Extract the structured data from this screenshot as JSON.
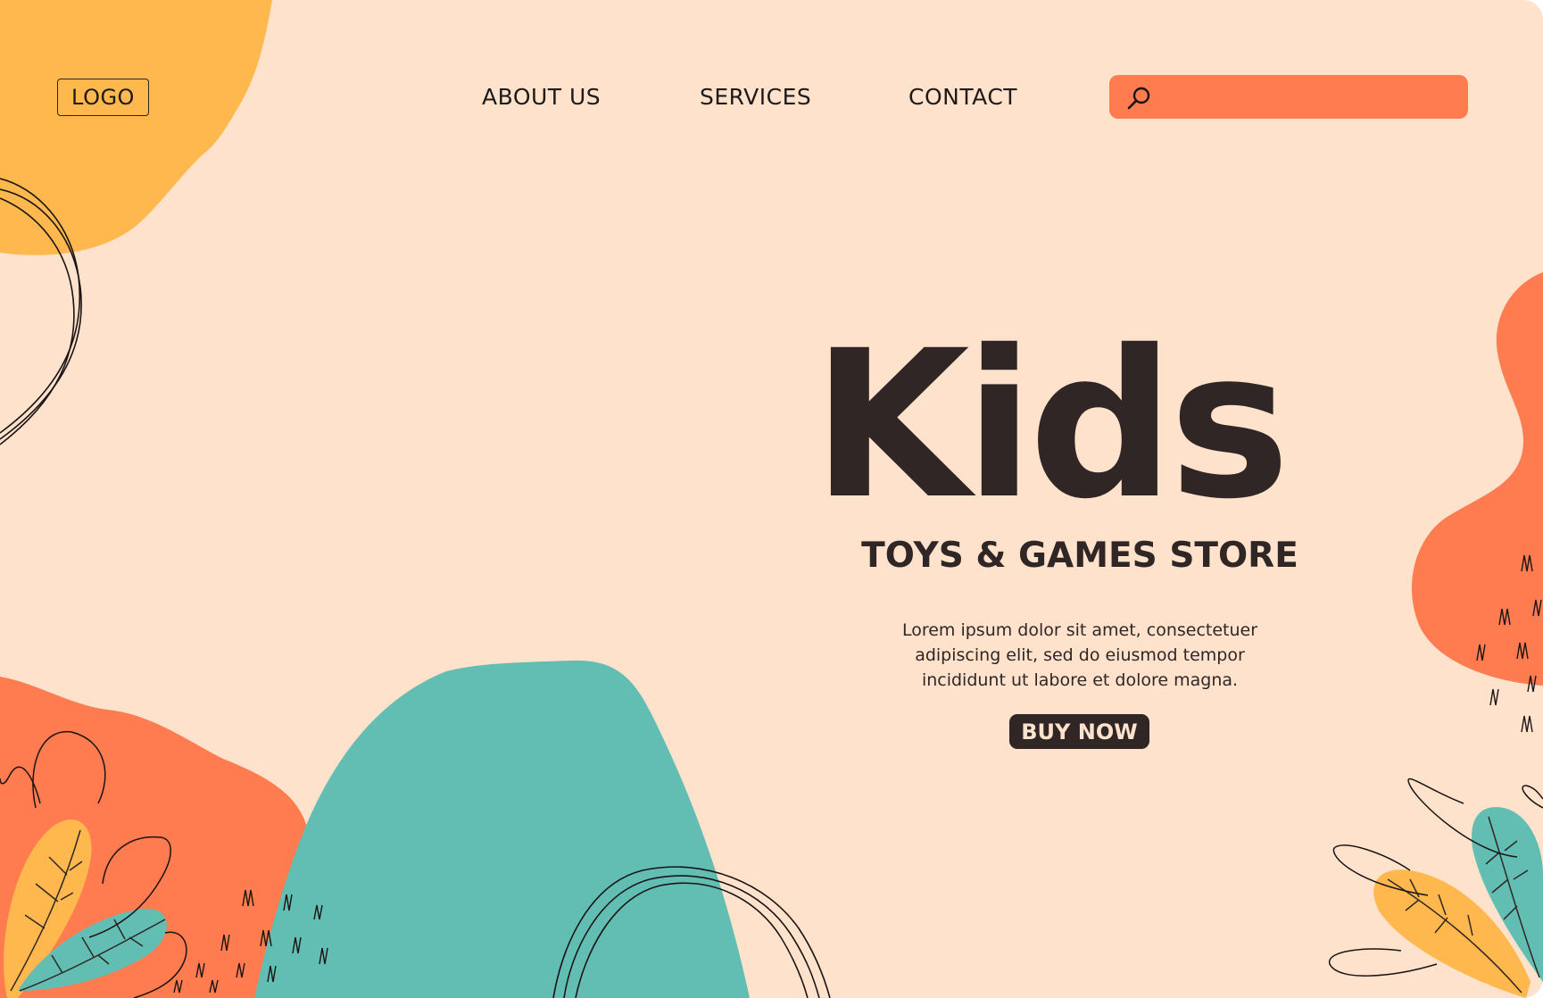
{
  "colors": {
    "background": "#ffe2cc",
    "yellow": "#ffb84d",
    "orange": "#fe7c4f",
    "teal": "#62beb3",
    "dark": "#2f2625"
  },
  "header": {
    "logo": "LOGO",
    "nav": [
      "ABOUT US",
      "SERVICES",
      "CONTACT"
    ],
    "search": {
      "icon": "search-icon",
      "value": "",
      "placeholder": ""
    }
  },
  "hero": {
    "title": "Kids",
    "subtitle": "TOYS & GAMES STORE",
    "description": [
      "Lorem ipsum dolor sit amet, consectetuer",
      "adipiscing elit, sed do eiusmod tempor",
      "incididunt ut labore et dolore magna."
    ],
    "button": "BUY NOW"
  }
}
